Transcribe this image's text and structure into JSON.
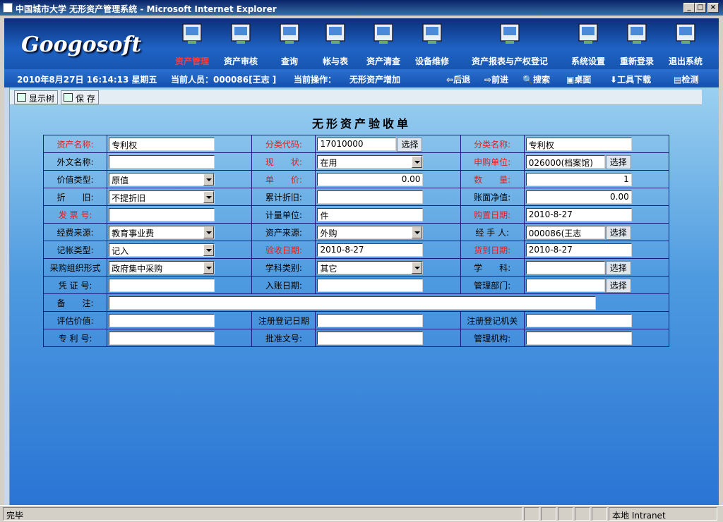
{
  "window": {
    "title": "中国城市大学 无形资产管理系统 - Microsoft Internet Explorer"
  },
  "brand": {
    "logo": "Googosoft"
  },
  "nav": [
    {
      "label": "资产管理",
      "icon": "asset-management-icon"
    },
    {
      "label": "资产审核",
      "icon": "asset-audit-icon"
    },
    {
      "label": "查询",
      "icon": "query-icon"
    },
    {
      "label": "帐与表",
      "icon": "ledger-icon"
    },
    {
      "label": "资产清查",
      "icon": "inventory-check-icon"
    },
    {
      "label": "设备维修",
      "icon": "repair-icon"
    },
    {
      "label": "资产报表与产权登记",
      "icon": "report-icon"
    },
    {
      "label": "系统设置",
      "icon": "settings-icon"
    },
    {
      "label": "重新登录",
      "icon": "relogin-icon"
    },
    {
      "label": "退出系统",
      "icon": "exit-icon"
    }
  ],
  "status": {
    "datetime": "2010年8月27日 16:14:13 星期五",
    "current_user": "当前人员：000086[王志 ]",
    "current_op_label": "当前操作：",
    "current_op": "无形资产增加",
    "back": "后退",
    "forward": "前进",
    "search": "搜索",
    "desktop": "桌面",
    "tool_download": "工具下载",
    "check": "检测"
  },
  "toolbar": {
    "show_tree": "显示树",
    "save": "保 存"
  },
  "form": {
    "title": "无形资产验收单",
    "rows": [
      [
        {
          "label": "资产名称:",
          "red": true,
          "type": "input",
          "value": "专利权"
        },
        {
          "label": "分类代码:",
          "red": true,
          "type": "input-pick",
          "value": "17010000",
          "pick": "选择"
        },
        {
          "label": "分类名称:",
          "red": true,
          "type": "input",
          "value": "专利权"
        }
      ],
      [
        {
          "label": "外文名称:",
          "red": false,
          "type": "input",
          "value": ""
        },
        {
          "label": "现　　状:",
          "red": true,
          "type": "select",
          "value": "在用"
        },
        {
          "label": "申购单位:",
          "red": true,
          "type": "input-pick",
          "value": "026000(档案馆)",
          "pick": "选择"
        }
      ],
      [
        {
          "label": "价值类型:",
          "red": false,
          "type": "select",
          "value": "原值"
        },
        {
          "label": "单　　价:",
          "red": true,
          "type": "num",
          "value": "0.00"
        },
        {
          "label": "数　　量:",
          "red": true,
          "type": "num",
          "value": "1"
        }
      ],
      [
        {
          "label": "折　　旧:",
          "red": false,
          "type": "select",
          "value": "不提折旧"
        },
        {
          "label": "累计折旧:",
          "red": false,
          "type": "input",
          "value": ""
        },
        {
          "label": "账面净值:",
          "red": false,
          "type": "num",
          "value": "0.00"
        }
      ],
      [
        {
          "label": "发 票 号:",
          "red": true,
          "type": "input",
          "value": ""
        },
        {
          "label": "计量单位:",
          "red": false,
          "type": "input",
          "value": "件"
        },
        {
          "label": "购置日期:",
          "red": true,
          "type": "input",
          "value": "2010-8-27"
        }
      ],
      [
        {
          "label": "经费来源:",
          "red": false,
          "type": "select",
          "value": "教育事业费"
        },
        {
          "label": "资产来源:",
          "red": false,
          "type": "select",
          "value": "外购"
        },
        {
          "label": "经 手 人:",
          "red": false,
          "type": "input-pick",
          "value": "000086(王志",
          "pick": "选择"
        }
      ],
      [
        {
          "label": "记帐类型:",
          "red": false,
          "type": "select",
          "value": "记入"
        },
        {
          "label": "验收日期:",
          "red": true,
          "type": "input",
          "value": "2010-8-27"
        },
        {
          "label": "货到日期:",
          "red": true,
          "type": "input",
          "value": "2010-8-27"
        }
      ],
      [
        {
          "label": "采购组织形式",
          "red": false,
          "type": "select",
          "value": "政府集中采购"
        },
        {
          "label": "学科类别:",
          "red": false,
          "type": "select",
          "value": "其它"
        },
        {
          "label": "学　　科:",
          "red": false,
          "type": "input-pick",
          "value": "",
          "pick": "选择"
        }
      ],
      [
        {
          "label": "凭 证 号:",
          "red": false,
          "type": "input",
          "value": ""
        },
        {
          "label": "入账日期:",
          "red": false,
          "type": "input",
          "value": ""
        },
        {
          "label": "管理部门:",
          "red": false,
          "type": "input-pick",
          "value": "",
          "pick": "选择"
        }
      ]
    ],
    "remark": {
      "label": "备　　注:",
      "value": ""
    },
    "rows2": [
      [
        {
          "label": "评估价值:",
          "red": false,
          "type": "input",
          "value": ""
        },
        {
          "label": "注册登记日期",
          "red": false,
          "type": "input",
          "value": ""
        },
        {
          "label": "注册登记机关",
          "red": false,
          "type": "input",
          "value": ""
        }
      ],
      [
        {
          "label": "专 利 号:",
          "red": false,
          "type": "input",
          "value": ""
        },
        {
          "label": "批准文号:",
          "red": false,
          "type": "input",
          "value": ""
        },
        {
          "label": "管理机构:",
          "red": false,
          "type": "input",
          "value": ""
        }
      ]
    ]
  },
  "ie_status": {
    "done": "完毕",
    "zone": "本地 Intranet"
  },
  "colors": {
    "header_dark": "#0a2f7a",
    "header_light": "#1f63c4",
    "content_top": "#9bd0f0",
    "content_bottom": "#2a74d4",
    "required_label": "#e02020",
    "active_nav": "#ff3a3a"
  }
}
